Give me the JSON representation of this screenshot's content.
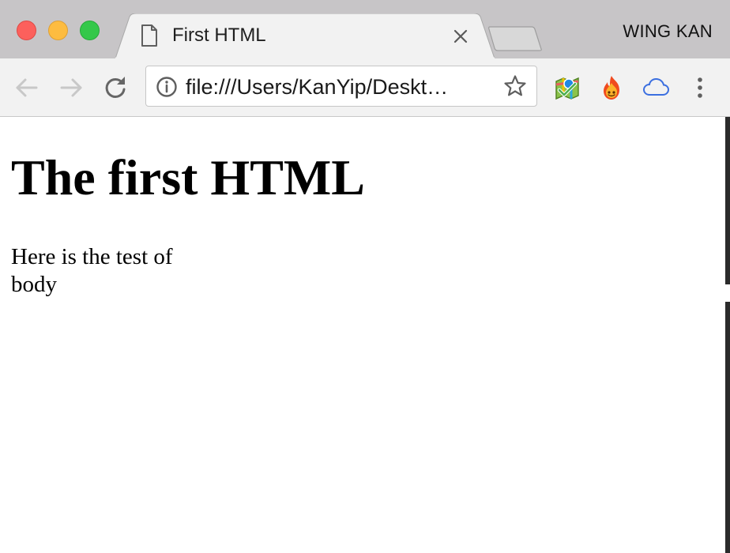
{
  "window": {
    "traffic_lights": {
      "close": "#fc605c",
      "minimize": "#fdbc40",
      "maximize": "#34c84a"
    }
  },
  "tab": {
    "title": "First HTML",
    "icon": "document-icon",
    "close_icon": "close-icon"
  },
  "profile": {
    "name": "WING KAN"
  },
  "toolbar": {
    "back_icon": "back-arrow-icon",
    "forward_icon": "forward-arrow-icon",
    "reload_icon": "reload-icon",
    "menu_icon": "more-vert-icon"
  },
  "omnibox": {
    "url": "file:///Users/KanYip/Deskt…",
    "info_icon": "info-icon",
    "bookmark_icon": "star-icon"
  },
  "extensions": [
    {
      "name": "map-check-icon"
    },
    {
      "name": "hola-flame-icon"
    },
    {
      "name": "cloud-icon"
    }
  ],
  "page": {
    "heading": "The first HTML",
    "body": "Here is the test of body"
  },
  "colors": {
    "tabstrip_bg": "#c7c5c7",
    "toolbar_bg": "#f2f2f2",
    "cloud_blue": "#3b6fe0"
  }
}
